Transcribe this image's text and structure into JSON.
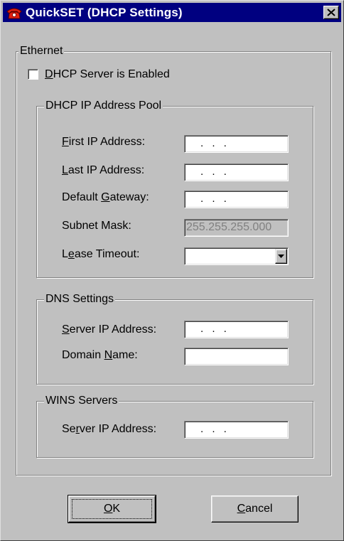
{
  "window": {
    "title": "QuickSET (DHCP Settings)",
    "app_icon": "red-phone-icon",
    "close_icon": "close-icon"
  },
  "ethernet": {
    "legend": "Ethernet",
    "dhcp_enabled": {
      "label_mnemonic": "D",
      "label_rest": "HCP Server is Enabled",
      "checked": false
    }
  },
  "pool": {
    "legend": "DHCP IP Address Pool",
    "first_ip": {
      "label_mnemonic": "F",
      "label_rest": "irst IP Address:",
      "value": ". . ."
    },
    "last_ip": {
      "label_mnemonic": "L",
      "label_rest": "ast IP Address:",
      "value": ". . ."
    },
    "gateway": {
      "label_pre": "Default ",
      "label_mnemonic": "G",
      "label_rest": "ateway:",
      "value": ". . ."
    },
    "subnet": {
      "label": "Subnet Mask:",
      "value": "255.255.255.000"
    },
    "lease": {
      "label_pre": "L",
      "label_mnemonic": "e",
      "label_rest": "ase Timeout:",
      "value": ""
    }
  },
  "dns": {
    "legend": "DNS Settings",
    "server_ip": {
      "label_mnemonic": "S",
      "label_rest": "erver IP Address:",
      "value": ". . ."
    },
    "domain": {
      "label_pre": "Domain ",
      "label_mnemonic": "N",
      "label_rest": "ame:",
      "value": ""
    }
  },
  "wins": {
    "legend": "WINS Servers",
    "server_ip": {
      "label_pre": "Se",
      "label_mnemonic": "r",
      "label_rest": "ver IP Address:",
      "value": ". . ."
    }
  },
  "buttons": {
    "ok": {
      "mnemonic": "O",
      "rest": "K"
    },
    "cancel": {
      "mnemonic": "C",
      "rest": "ancel"
    }
  },
  "colors": {
    "face": "#c0c0c0",
    "titlebar": "#000080",
    "disabled_text": "#808080"
  }
}
